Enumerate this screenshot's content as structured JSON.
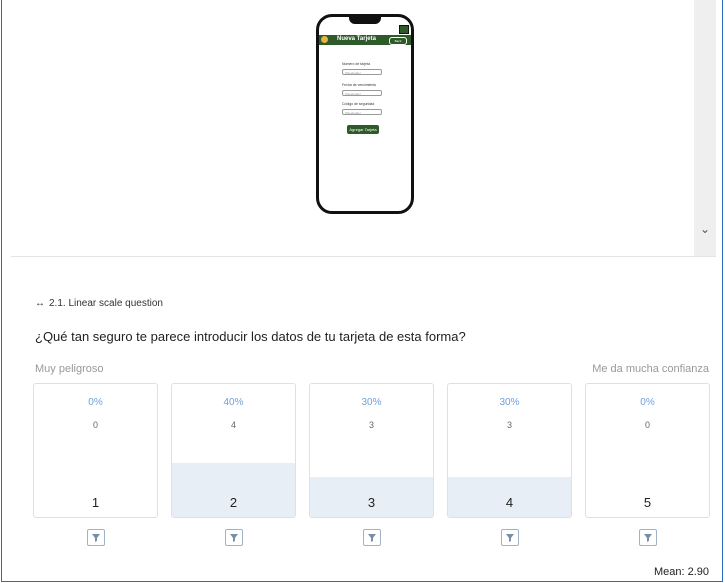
{
  "preview": {
    "app_title": "Nueva Tarjeta",
    "app_button": "Back",
    "fields": [
      {
        "label": "Número de tarjeta",
        "placeholder": "Placeholder"
      },
      {
        "label": "Fecha de vencimiento",
        "placeholder": "Placeholder"
      },
      {
        "label": "Código de seguridad",
        "placeholder": "Placeholder"
      }
    ],
    "submit_label": "Agregar Tarjeta"
  },
  "question": {
    "type_label": "2.1. Linear scale question",
    "text": "¿Qué tan seguro te parece introducir los datos de tu tarjeta de esta forma?",
    "min_label": "Muy peligroso",
    "max_label": "Me da mucha confianza"
  },
  "scale": [
    {
      "value": "1",
      "percent": "0%",
      "count": "0",
      "share": 0
    },
    {
      "value": "2",
      "percent": "40%",
      "count": "4",
      "share": 0.4
    },
    {
      "value": "3",
      "percent": "30%",
      "count": "3",
      "share": 0.3
    },
    {
      "value": "4",
      "percent": "30%",
      "count": "3",
      "share": 0.3
    },
    {
      "value": "5",
      "percent": "0%",
      "count": "0",
      "share": 0
    }
  ],
  "mean_text": "Mean: 2.90"
}
